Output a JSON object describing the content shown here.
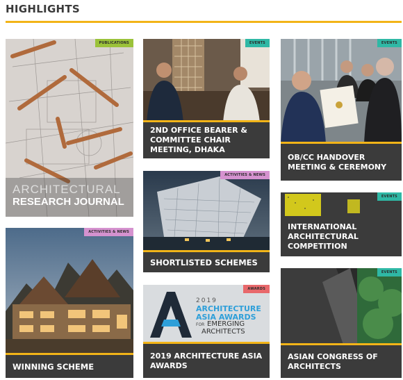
{
  "header": {
    "title": "HIGHLIGHTS"
  },
  "colors": {
    "accent": "#f2b418",
    "caption_bg": "#3b3b3b"
  },
  "cards": {
    "journal": {
      "tag": "PUBLICATIONS",
      "title_line1": "ARCHITECTURAL",
      "title_line2": "RESEARCH JOURNAL"
    },
    "winning": {
      "tag": "ACTIVITIES & NEWS",
      "caption": "WINNING SCHEME"
    },
    "dhaka": {
      "tag": "EVENTS",
      "caption": "2ND OFFICE BEARER & COMMITTEE CHAIR MEETING, DHAKA"
    },
    "shortlisted": {
      "tag": "ACTIVITIES & NEWS",
      "caption": "SHORTLISTED SCHEMES"
    },
    "awards": {
      "tag": "AWARDS",
      "caption": "2019 ARCHITECTURE ASIA AWARDS",
      "banner_year": "2019",
      "banner_line1": "ARCHITECTURE",
      "banner_line2": "ASIA AWARDS",
      "banner_for": "FOR",
      "banner_line3": "EMERGING",
      "banner_line4": "ARCHITECTS"
    },
    "handover": {
      "tag": "EVENTS",
      "caption": "OB/CC HANDOVER MEETING & CEREMONY"
    },
    "competition": {
      "tag": "EVENTS",
      "caption": "INTERNATIONAL ARCHITECTURAL COMPETITION"
    },
    "congress": {
      "tag": "EVENTS",
      "caption": "ASIAN CONGRESS OF ARCHITECTS"
    }
  }
}
